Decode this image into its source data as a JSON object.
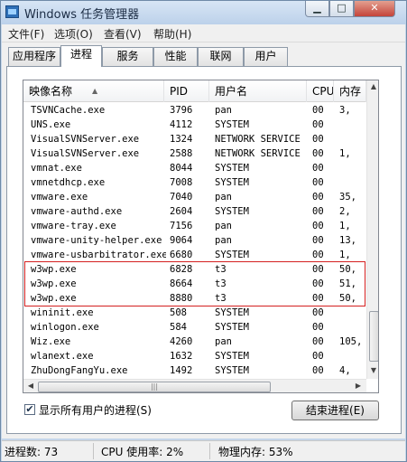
{
  "window": {
    "title": "Windows 任务管理器",
    "min_label": "▁",
    "max_label": "□",
    "close_label": "✕"
  },
  "menu": [
    "文件(F)",
    "选项(O)",
    "查看(V)",
    "帮助(H)"
  ],
  "tabs": [
    "应用程序",
    "进程",
    "服务",
    "性能",
    "联网",
    "用户"
  ],
  "active_tab": "进程",
  "columns": [
    "映像名称",
    "PID",
    "用户名",
    "CPU",
    "内存"
  ],
  "processes": [
    {
      "name": "TSVNCache.exe",
      "pid": "3796",
      "user": "pan",
      "cpu": "00",
      "mem": "3,"
    },
    {
      "name": "UNS.exe",
      "pid": "4112",
      "user": "SYSTEM",
      "cpu": "00",
      "mem": ""
    },
    {
      "name": "VisualSVNServer.exe",
      "pid": "1324",
      "user": "NETWORK SERVICE",
      "cpu": "00",
      "mem": ""
    },
    {
      "name": "VisualSVNServer.exe",
      "pid": "2588",
      "user": "NETWORK SERVICE",
      "cpu": "00",
      "mem": "1,"
    },
    {
      "name": "vmnat.exe",
      "pid": "8044",
      "user": "SYSTEM",
      "cpu": "00",
      "mem": ""
    },
    {
      "name": "vmnetdhcp.exe",
      "pid": "7008",
      "user": "SYSTEM",
      "cpu": "00",
      "mem": ""
    },
    {
      "name": "vmware.exe",
      "pid": "7040",
      "user": "pan",
      "cpu": "00",
      "mem": "35,"
    },
    {
      "name": "vmware-authd.exe",
      "pid": "2604",
      "user": "SYSTEM",
      "cpu": "00",
      "mem": "2,"
    },
    {
      "name": "vmware-tray.exe",
      "pid": "7156",
      "user": "pan",
      "cpu": "00",
      "mem": "1,"
    },
    {
      "name": "vmware-unity-helper.exe",
      "pid": "9064",
      "user": "pan",
      "cpu": "00",
      "mem": "13,"
    },
    {
      "name": "vmware-usbarbitrator.exe",
      "pid": "6680",
      "user": "SYSTEM",
      "cpu": "00",
      "mem": "1,"
    },
    {
      "name": "w3wp.exe",
      "pid": "6828",
      "user": "t3",
      "cpu": "00",
      "mem": "50,"
    },
    {
      "name": "w3wp.exe",
      "pid": "8664",
      "user": "t3",
      "cpu": "00",
      "mem": "51,"
    },
    {
      "name": "w3wp.exe",
      "pid": "8880",
      "user": "t3",
      "cpu": "00",
      "mem": "50,"
    },
    {
      "name": "wininit.exe",
      "pid": "508",
      "user": "SYSTEM",
      "cpu": "00",
      "mem": ""
    },
    {
      "name": "winlogon.exe",
      "pid": "584",
      "user": "SYSTEM",
      "cpu": "00",
      "mem": ""
    },
    {
      "name": "Wiz.exe",
      "pid": "4260",
      "user": "pan",
      "cpu": "00",
      "mem": "105,"
    },
    {
      "name": "wlanext.exe",
      "pid": "1632",
      "user": "SYSTEM",
      "cpu": "00",
      "mem": ""
    },
    {
      "name": "ZhuDongFangYu.exe",
      "pid": "1492",
      "user": "SYSTEM",
      "cpu": "00",
      "mem": "4,"
    }
  ],
  "highlighted_rows": [
    11,
    12,
    13
  ],
  "highlight_color": "#d42020",
  "show_all_users": {
    "label": "显示所有用户的进程(S)",
    "checked": true,
    "check_glyph": "✔"
  },
  "end_process_label": "结束进程(E)",
  "status": {
    "process_count": "进程数: 73",
    "cpu_usage": "CPU 使用率: 2%",
    "memory": "物理内存: 53%"
  }
}
